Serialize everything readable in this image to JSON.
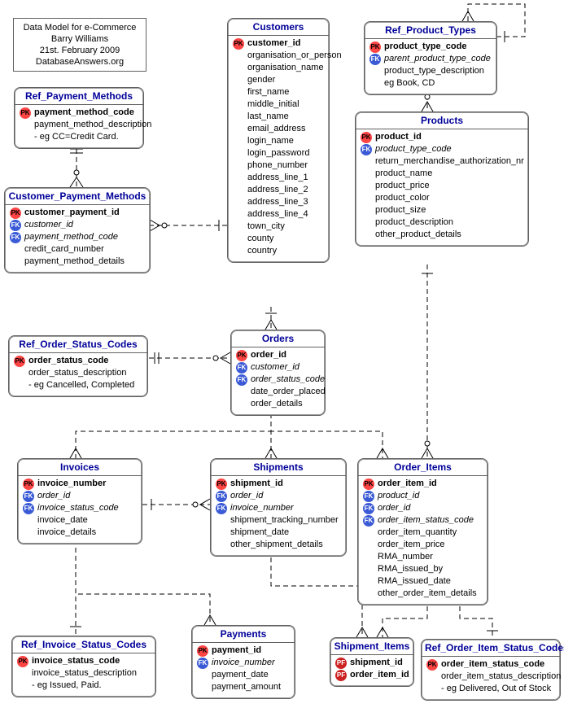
{
  "note": {
    "line1": "Data Model for e-Commerce",
    "line2": "Barry Williams",
    "line3": "21st. February 2009",
    "line4": "DatabaseAnswers.org"
  },
  "entities": {
    "ref_payment_methods": {
      "title": "Ref_Payment_Methods",
      "cols": [
        "payment_method_code",
        "payment_method_description",
        "- eg CC=Credit Card."
      ]
    },
    "customer_payment_methods": {
      "title": "Customer_Payment_Methods",
      "cols": [
        "customer_payment_id",
        "customer_id",
        "payment_method_code",
        "credit_card_number",
        "payment_method_details"
      ]
    },
    "customers": {
      "title": "Customers",
      "cols": [
        "customer_id",
        "organisation_or_person",
        "organisation_name",
        "gender",
        "first_name",
        "middle_initial",
        "last_name",
        "email_address",
        "login_name",
        "login_password",
        "phone_number",
        "address_line_1",
        "address_line_2",
        "address_line_3",
        "address_line_4",
        "town_city",
        "county",
        "country"
      ]
    },
    "ref_product_types": {
      "title": "Ref_Product_Types",
      "cols": [
        "product_type_code",
        "parent_product_type_code",
        "product_type_description",
        "eg Book, CD"
      ]
    },
    "products": {
      "title": "Products",
      "cols": [
        "product_id",
        "product_type_code",
        "return_merchandise_authorization_nr",
        "product_name",
        "product_price",
        "product_color",
        "product_size",
        "product_description",
        "other_product_details"
      ]
    },
    "orders": {
      "title": "Orders",
      "cols": [
        "order_id",
        "customer_id",
        "order_status_code",
        "date_order_placed",
        "order_details"
      ]
    },
    "ref_order_status_codes": {
      "title": "Ref_Order_Status_Codes",
      "cols": [
        "order_status_code",
        "order_status_description",
        "- eg Cancelled, Completed"
      ]
    },
    "invoices": {
      "title": "Invoices",
      "cols": [
        "invoice_number",
        "order_id",
        "invoice_status_code",
        "invoice_date",
        "invoice_details"
      ]
    },
    "shipments": {
      "title": "Shipments",
      "cols": [
        "shipment_id",
        "order_id",
        "invoice_number",
        "shipment_tracking_number",
        "shipment_date",
        "other_shipment_details"
      ]
    },
    "order_items": {
      "title": "Order_Items",
      "cols": [
        "order_item_id",
        "product_id",
        "order_id",
        "order_item_status_code",
        "order_item_quantity",
        "order_item_price",
        "RMA_number",
        "RMA_issued_by",
        "RMA_issued_date",
        "other_order_item_details"
      ]
    },
    "ref_invoice_status_codes": {
      "title": "Ref_Invoice_Status_Codes",
      "cols": [
        "invoice_status_code",
        "invoice_status_description",
        "- eg Issued, Paid."
      ]
    },
    "payments": {
      "title": "Payments",
      "cols": [
        "payment_id",
        "invoice_number",
        "payment_date",
        "payment_amount"
      ]
    },
    "shipment_items": {
      "title": "Shipment_Items",
      "cols": [
        "shipment_id",
        "order_item_id"
      ]
    },
    "ref_order_item_status_codes": {
      "title": "Ref_Order_Item_Status_Codes",
      "cols": [
        "order_item_status_code",
        "order_item_status_description",
        "- eg Delivered, Out of Stock"
      ]
    }
  }
}
